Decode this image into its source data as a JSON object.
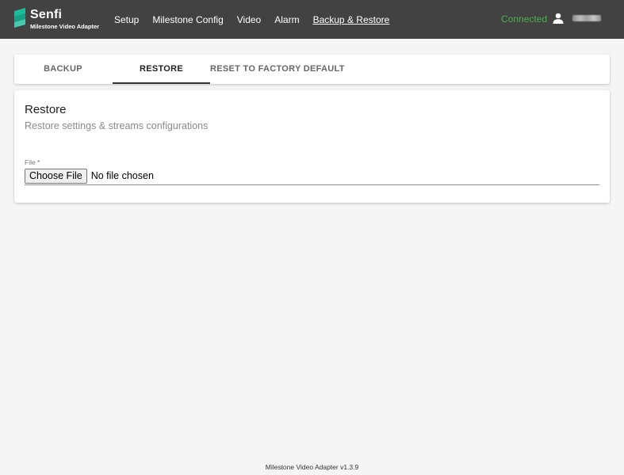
{
  "header": {
    "brand": "Senfi",
    "brand_subtitle": "Milestone Video Adapter",
    "nav": [
      {
        "label": "Setup",
        "active": false
      },
      {
        "label": "Milestone Config",
        "active": false
      },
      {
        "label": "Video",
        "active": false
      },
      {
        "label": "Alarm",
        "active": false
      },
      {
        "label": "Backup & Restore",
        "active": true
      }
    ],
    "status": "Connected",
    "colors": {
      "bar": "#424242",
      "status": "#4caf50",
      "logo": "#1abc9c"
    },
    "icons": {
      "user": "user-icon",
      "logo": "senfi-logo-icon"
    }
  },
  "tabs": [
    {
      "label": "BACKUP",
      "active": false
    },
    {
      "label": "RESTORE",
      "active": true
    },
    {
      "label": "RESET TO FACTORY DEFAULT",
      "active": false
    }
  ],
  "restore": {
    "title": "Restore",
    "subtitle": "Restore settings & streams configurations",
    "file_label": "File *",
    "choose_button": "Choose File",
    "file_status": "No file chosen"
  },
  "footer": {
    "version_text": "Milestone Video Adapter v1.3.9"
  }
}
